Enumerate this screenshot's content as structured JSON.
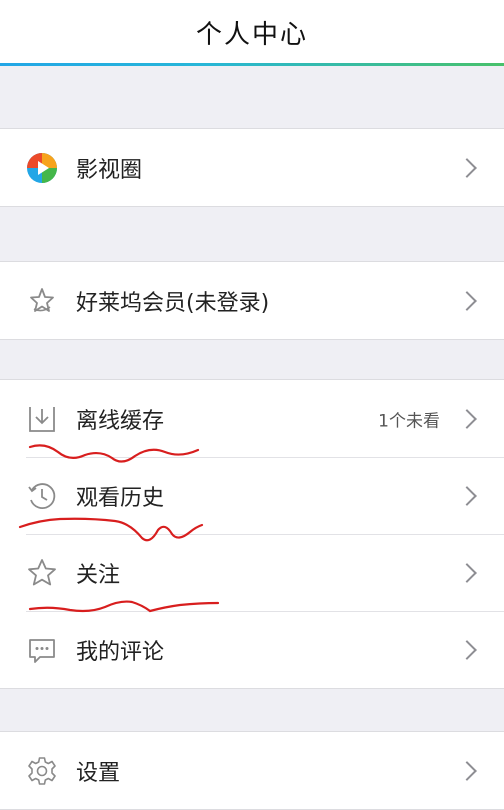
{
  "header": {
    "title": "个人中心"
  },
  "sections": [
    {
      "items": [
        {
          "key": "circle",
          "label": "影视圈",
          "icon": "play-circle-icon"
        }
      ]
    },
    {
      "items": [
        {
          "key": "vip",
          "label": "好莱坞会员(未登录)",
          "icon": "star-badge-icon"
        }
      ]
    },
    {
      "items": [
        {
          "key": "offline",
          "label": "离线缓存",
          "extra": "1个未看",
          "icon": "download-icon"
        },
        {
          "key": "history",
          "label": "观看历史",
          "icon": "history-clock-icon"
        },
        {
          "key": "follow",
          "label": "关注",
          "icon": "star-outline-icon"
        },
        {
          "key": "comments",
          "label": "我的评论",
          "icon": "comment-icon"
        }
      ]
    },
    {
      "items": [
        {
          "key": "settings",
          "label": "设置",
          "icon": "gear-icon"
        }
      ]
    }
  ],
  "colors": {
    "accent": "#17a9e0",
    "background": "#efeff4",
    "scribble": "#d81e1e"
  }
}
